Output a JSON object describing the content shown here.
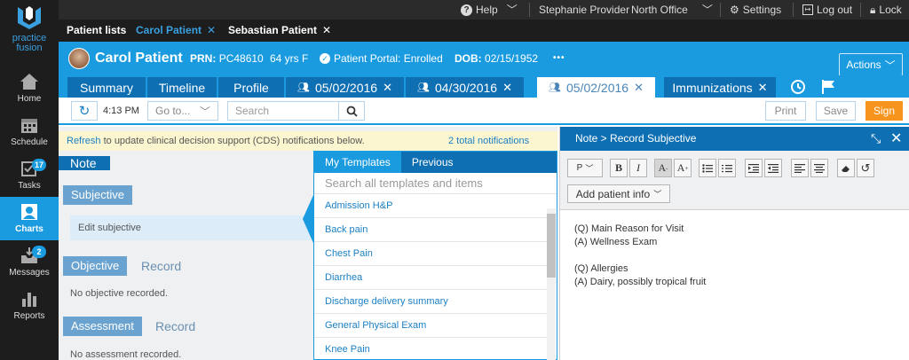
{
  "leftnav": {
    "brand_line1": "practice",
    "brand_line2": "fusion",
    "items": [
      {
        "label": "Home",
        "icon": "home-icon"
      },
      {
        "label": "Schedule",
        "icon": "calendar-icon"
      },
      {
        "label": "Tasks",
        "icon": "tasks-icon",
        "badge": "17"
      },
      {
        "label": "Charts",
        "icon": "person-icon",
        "active": true
      },
      {
        "label": "Messages",
        "icon": "inbox-icon",
        "badge": "2"
      },
      {
        "label": "Reports",
        "icon": "bar-chart-icon"
      }
    ]
  },
  "topbar": {
    "help": "Help",
    "user": "Stephanie Provider",
    "office": "North Office",
    "settings": "Settings",
    "logout": "Log out",
    "lock": "Lock"
  },
  "patient_tabs": {
    "patient_lists": "Patient lists",
    "tab1": "Carol Patient",
    "tab2": "Sebastian Patient"
  },
  "patient_header": {
    "name": "Carol Patient",
    "prn_label": "PRN:",
    "prn": "PC48610",
    "age_sex": "64 yrs F",
    "portal": "Patient Portal: Enrolled",
    "dob_label": "DOB:",
    "dob": "02/15/1952",
    "more": "•••",
    "actions": "Actions"
  },
  "chart_tabs": {
    "summary": "Summary",
    "timeline": "Timeline",
    "profile": "Profile",
    "enc1": "05/02/2016",
    "enc2": "04/30/2016",
    "enc3": "05/02/2016",
    "immunizations": "Immunizations"
  },
  "toolbar": {
    "time": "4:13 PM",
    "goto": "Go to...",
    "search_placeholder": "Search",
    "print": "Print",
    "save": "Save",
    "sign": "Sign"
  },
  "cds": {
    "refresh": "Refresh",
    "message": " to update clinical decision support (CDS) notifications below.",
    "notifications": "2 total notifications"
  },
  "note": {
    "title": "Note",
    "subjective": "Subjective",
    "edit_subjective": "Edit subjective",
    "objective": "Objective",
    "record1": "Record",
    "no_objective": "No objective recorded.",
    "assessment": "Assessment",
    "record2": "Record",
    "no_assessment": "No assessment recorded."
  },
  "templates": {
    "tab_my": "My Templates",
    "tab_previous": "Previous",
    "search_placeholder": "Search all templates and items",
    "items": [
      "Admission H&P",
      "Back pain",
      "Chest Pain",
      "Diarrhea",
      "Discharge delivery summary",
      "General Physical Exam",
      "Knee Pain"
    ]
  },
  "right_panel": {
    "breadcrumb": "Note > Record Subjective",
    "paragraph": "P",
    "bold": "B",
    "italic": "I",
    "font_down": "A",
    "font_up": "A",
    "add_patient_info": "Add patient info",
    "lines": [
      "(Q) Main Reason for Visit",
      "(A) Wellness Exam",
      "",
      "(Q) Allergies",
      "(A) Dairy, possibly tropical fruit"
    ]
  },
  "colors": {
    "brand_blue": "#1a9be0",
    "dark_blue": "#0f6fb3",
    "sign_orange": "#f7941d"
  }
}
